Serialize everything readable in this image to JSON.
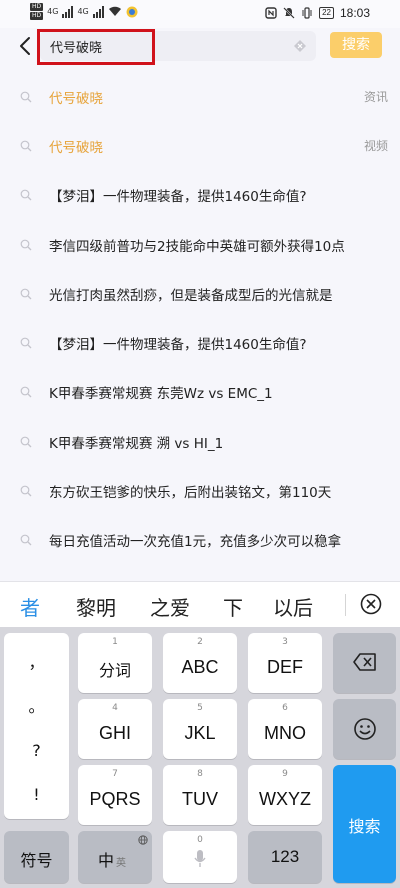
{
  "status_bar": {
    "hd1": "HD",
    "hd2": "HD",
    "net1": "4G",
    "net2": "4G",
    "battery": "22",
    "time": "18:03"
  },
  "search": {
    "query": "代号破晓",
    "button": "搜索"
  },
  "suggestions": [
    {
      "text": "代号破晓",
      "tag": "资讯",
      "highlight": true
    },
    {
      "text": "代号破晓",
      "tag": "视频",
      "highlight": true
    },
    {
      "text": "【梦泪】一件物理装备，提供1460生命值?",
      "tag": "",
      "highlight": false
    },
    {
      "text": "李信四级前普功与2技能命中英雄可额外获得10点",
      "tag": "",
      "highlight": false
    },
    {
      "text": "光信打肉虽然刮痧，但是装备成型后的光信就是",
      "tag": "",
      "highlight": false
    },
    {
      "text": "【梦泪】一件物理装备，提供1460生命值?",
      "tag": "",
      "highlight": false
    },
    {
      "text": "K甲春季赛常规赛 东莞Wz vs EMC_1",
      "tag": "",
      "highlight": false
    },
    {
      "text": "K甲春季赛常规赛 溯 vs HI_1",
      "tag": "",
      "highlight": false
    },
    {
      "text": "东方砍王铠爹的快乐，后附出装铭文，第110天",
      "tag": "",
      "highlight": false
    },
    {
      "text": "每日充值活动一次充值1元，充值多少次可以稳拿",
      "tag": "",
      "highlight": false
    }
  ],
  "candidates": [
    "者",
    "黎明",
    "之爱",
    "下",
    "以后"
  ],
  "keyboard": {
    "punct": [
      "，",
      "。",
      "?",
      "!"
    ],
    "keys": [
      {
        "num": "1",
        "label": "分词"
      },
      {
        "num": "2",
        "label": "ABC"
      },
      {
        "num": "3",
        "label": "DEF"
      },
      {
        "num": "4",
        "label": "GHI"
      },
      {
        "num": "5",
        "label": "JKL"
      },
      {
        "num": "6",
        "label": "MNO"
      },
      {
        "num": "7",
        "label": "PQRS"
      },
      {
        "num": "8",
        "label": "TUV"
      },
      {
        "num": "9",
        "label": "WXYZ"
      }
    ],
    "symbol": "符号",
    "lang_main": "中",
    "lang_sub": "英",
    "space_num": "0",
    "numbers": "123",
    "enter": "搜索"
  },
  "colors": {
    "accent_orange": "#e7a43b",
    "search_button": "#fbce6a",
    "enter_key": "#1f9bf0",
    "candidate_active": "#2b8fe5",
    "annotation_box": "#d0121b"
  },
  "icons": [
    "back-arrow-icon",
    "clear-icon",
    "search-icon",
    "backspace-icon",
    "emoji-icon",
    "microphone-icon",
    "globe-icon",
    "keyboard-close-icon"
  ]
}
